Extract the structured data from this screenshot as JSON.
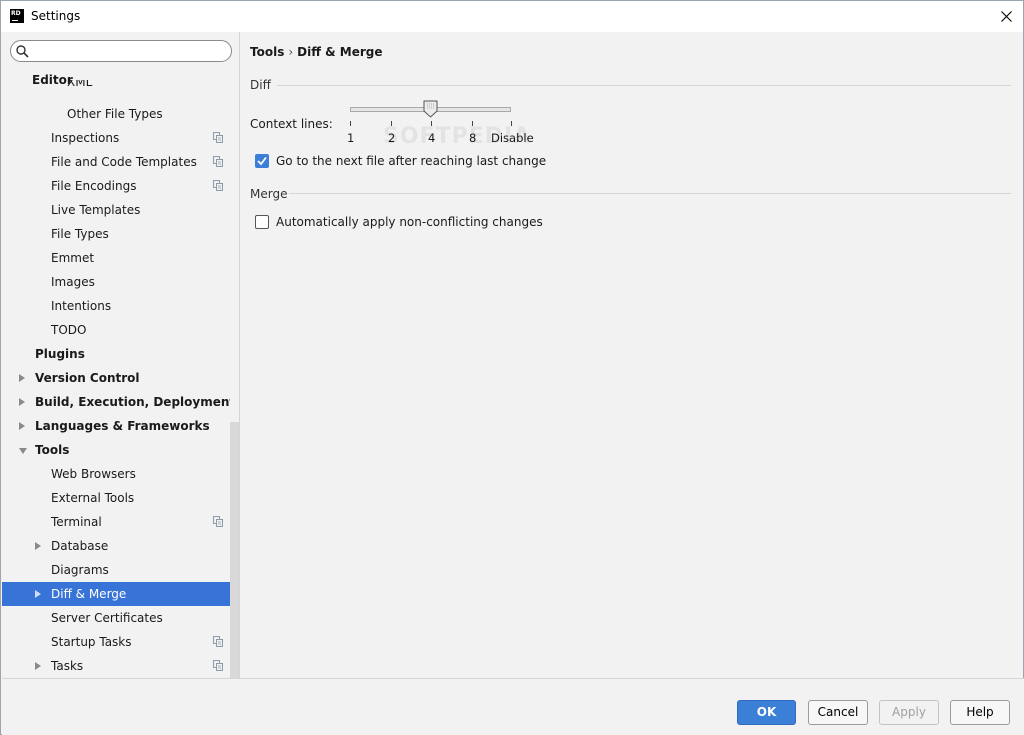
{
  "window": {
    "title": "Settings",
    "app_icon_text": "RD"
  },
  "search": {
    "placeholder": "",
    "value": ""
  },
  "sidebar": {
    "items": [
      {
        "label": "XML",
        "bold": false,
        "indent": 65,
        "arrow": "",
        "copy": false,
        "partial": true
      },
      {
        "label": "Editor",
        "bold": true,
        "indent": 30,
        "arrow": "",
        "copy": false
      },
      {
        "label": "Other File Types",
        "bold": false,
        "indent": 65,
        "arrow": "",
        "copy": false
      },
      {
        "label": "Inspections",
        "bold": false,
        "indent": 49,
        "arrow": "",
        "copy": true
      },
      {
        "label": "File and Code Templates",
        "bold": false,
        "indent": 49,
        "arrow": "",
        "copy": true
      },
      {
        "label": "File Encodings",
        "bold": false,
        "indent": 49,
        "arrow": "",
        "copy": true
      },
      {
        "label": "Live Templates",
        "bold": false,
        "indent": 49,
        "arrow": "",
        "copy": false
      },
      {
        "label": "File Types",
        "bold": false,
        "indent": 49,
        "arrow": "",
        "copy": false
      },
      {
        "label": "Emmet",
        "bold": false,
        "indent": 49,
        "arrow": "",
        "copy": false
      },
      {
        "label": "Images",
        "bold": false,
        "indent": 49,
        "arrow": "",
        "copy": false
      },
      {
        "label": "Intentions",
        "bold": false,
        "indent": 49,
        "arrow": "",
        "copy": false
      },
      {
        "label": "TODO",
        "bold": false,
        "indent": 49,
        "arrow": "",
        "copy": false
      },
      {
        "label": "Plugins",
        "bold": true,
        "indent": 33,
        "arrow": "",
        "copy": false
      },
      {
        "label": "Version Control",
        "bold": true,
        "indent": 33,
        "arrow": "right",
        "copy": false
      },
      {
        "label": "Build, Execution, Deployment",
        "bold": true,
        "indent": 33,
        "arrow": "right",
        "copy": false
      },
      {
        "label": "Languages & Frameworks",
        "bold": true,
        "indent": 33,
        "arrow": "right",
        "copy": false
      },
      {
        "label": "Tools",
        "bold": true,
        "indent": 33,
        "arrow": "down",
        "copy": false
      },
      {
        "label": "Web Browsers",
        "bold": false,
        "indent": 49,
        "arrow": "",
        "copy": false
      },
      {
        "label": "External Tools",
        "bold": false,
        "indent": 49,
        "arrow": "",
        "copy": false
      },
      {
        "label": "Terminal",
        "bold": false,
        "indent": 49,
        "arrow": "",
        "copy": true
      },
      {
        "label": "Database",
        "bold": false,
        "indent": 49,
        "arrow": "right",
        "copy": false
      },
      {
        "label": "Diagrams",
        "bold": false,
        "indent": 49,
        "arrow": "",
        "copy": false
      },
      {
        "label": "Diff & Merge",
        "bold": false,
        "indent": 49,
        "arrow": "right",
        "copy": false,
        "selected": true
      },
      {
        "label": "Server Certificates",
        "bold": false,
        "indent": 49,
        "arrow": "",
        "copy": false
      },
      {
        "label": "Startup Tasks",
        "bold": false,
        "indent": 49,
        "arrow": "",
        "copy": true
      },
      {
        "label": "Tasks",
        "bold": false,
        "indent": 49,
        "arrow": "right",
        "copy": true
      }
    ]
  },
  "breadcrumb": {
    "parent": "Tools",
    "separator": "›",
    "current": "Diff & Merge"
  },
  "diff": {
    "section_title": "Diff",
    "context_label": "Context lines:",
    "slider": {
      "ticks": [
        "1",
        "2",
        "4",
        "8",
        "Disable"
      ],
      "selected": "4"
    },
    "next_file": {
      "label": "Go to the next file after reaching last change",
      "checked": true
    }
  },
  "merge": {
    "section_title": "Merge",
    "auto_apply": {
      "label": "Automatically apply non-conflicting changes",
      "checked": false
    }
  },
  "watermark": "SOFTPEDIA",
  "buttons": {
    "ok": "OK",
    "cancel": "Cancel",
    "apply": "Apply",
    "help": "Help"
  },
  "colors": {
    "selection": "#3874d8",
    "accent": "#3c7fd6"
  }
}
